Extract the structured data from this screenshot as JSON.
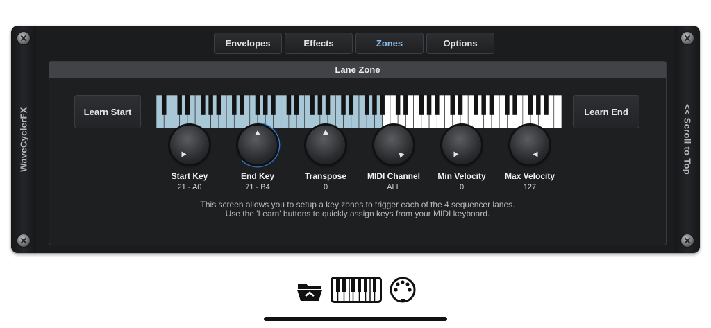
{
  "rails": {
    "left_title": "WaveCyclerFX",
    "right_link": "<< Scroll to Top"
  },
  "tabs": [
    {
      "label": "Envelopes",
      "active": false
    },
    {
      "label": "Effects",
      "active": false
    },
    {
      "label": "Zones",
      "active": true
    },
    {
      "label": "Options",
      "active": false
    }
  ],
  "panel": {
    "title": "Lane Zone"
  },
  "buttons": {
    "learn_start": "Learn Start",
    "learn_end": "Learn End"
  },
  "keyboard": {
    "white_keys": 52,
    "selected_white_keys": 29,
    "selected_color": "#a8c8d8"
  },
  "knobs": [
    {
      "label": "Start Key",
      "value": "21 - A0"
    },
    {
      "label": "End Key",
      "value": "71 - B4"
    },
    {
      "label": "Transpose",
      "value": "0"
    },
    {
      "label": "MIDI Channel",
      "value": "ALL"
    },
    {
      "label": "Min Velocity",
      "value": "0"
    },
    {
      "label": "Max Velocity",
      "value": "127"
    }
  ],
  "info": {
    "line1": "This screen allows you to setup a key zones to trigger each of the 4 sequencer lanes.",
    "line2": "Use the 'Learn' buttons to quickly assign keys from your MIDI keyboard."
  },
  "dock": {
    "icons": [
      "folder-icon",
      "piano-keyboard-icon",
      "midi-connector-icon"
    ]
  },
  "colors": {
    "accent": "#8bbbe6",
    "knob_ring": "#3a7fd5"
  }
}
